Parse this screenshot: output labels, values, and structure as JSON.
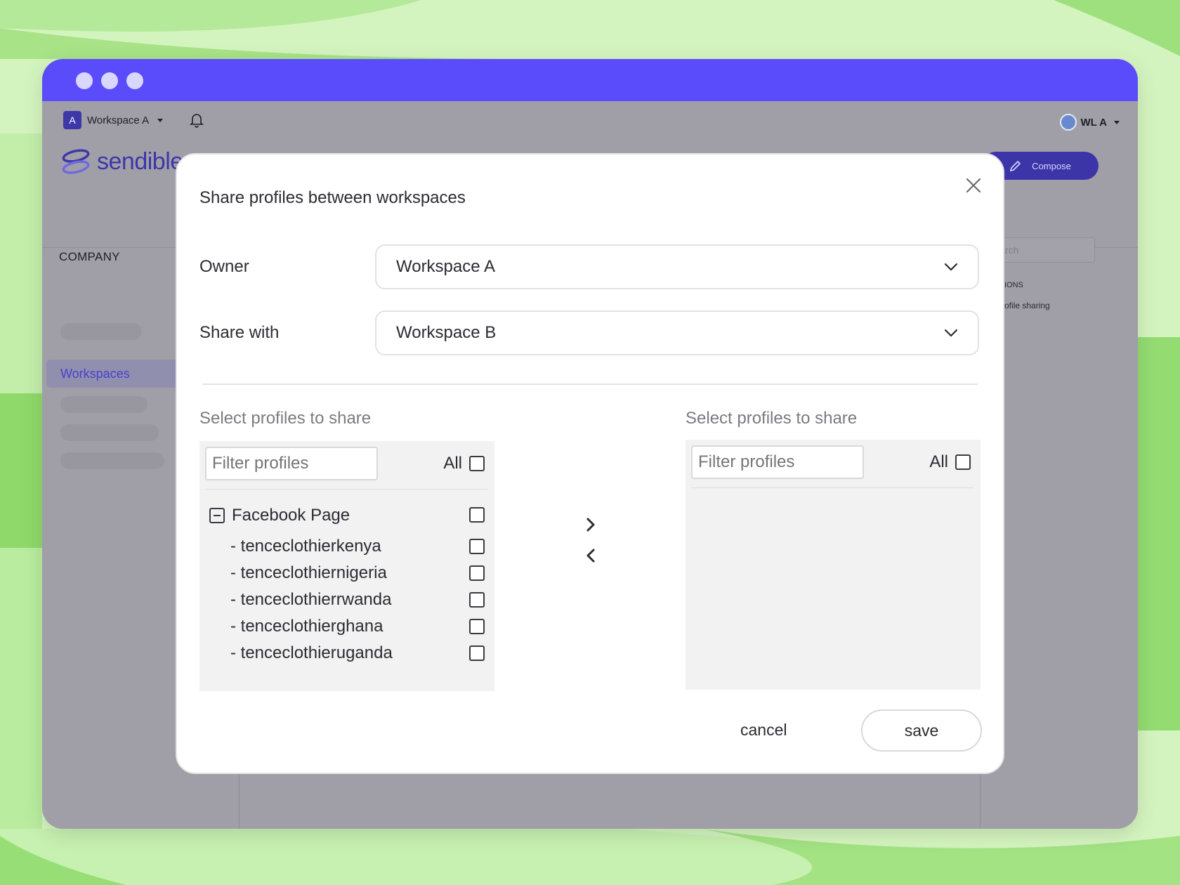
{
  "app": {
    "workspace_switcher": {
      "badge": "A",
      "label": "Workspace A"
    },
    "user": {
      "label": "WL A"
    },
    "logo_text": "sendible",
    "compose_label": "Compose",
    "search_placeholder": "Search",
    "sidebar": {
      "heading": "COMPANY",
      "active_item": "Workspaces"
    },
    "right_panel": {
      "section": "IONS",
      "link": "ofile sharing"
    }
  },
  "modal": {
    "title": "Share profiles between workspaces",
    "owner": {
      "label": "Owner",
      "value": "Workspace A"
    },
    "share_with": {
      "label": "Share with",
      "value": "Workspace B"
    },
    "left_panel": {
      "title": "Select profiles to share",
      "filter_placeholder": "Filter profiles",
      "all_label": "All",
      "group": "Facebook Page",
      "profiles": [
        "- tenceclothierkenya",
        "- tenceclothiernigeria",
        "- tenceclothierrwanda",
        "- tenceclothierghana",
        "- tenceclothieruganda"
      ]
    },
    "right_panel": {
      "title": "Select profiles to share",
      "filter_placeholder": "Filter profiles",
      "all_label": "All"
    },
    "cancel_label": "cancel",
    "save_label": "save"
  },
  "colors": {
    "titlebar": "#5b4cfb",
    "brand": "#3d37a8",
    "background_green": "#c9f0ad"
  }
}
